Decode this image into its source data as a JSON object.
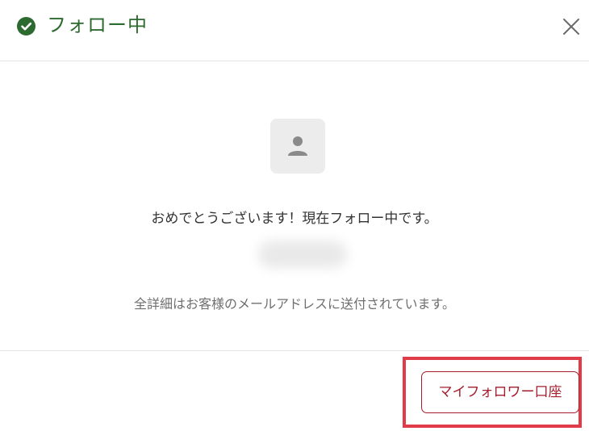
{
  "dialog": {
    "title": "フォロー中",
    "status_icon": "check-circle-icon",
    "close_icon": "close-icon",
    "accent_color": "#2d6a2f"
  },
  "body": {
    "avatar_icon": "user-placeholder-icon",
    "congrats_message": "おめでとうございます！現在フォロー中です。",
    "details_message": "全詳細はお客様のメールアドレスに送付されています。"
  },
  "footer": {
    "my_follow_account_label": "マイフォロワー口座",
    "button_color": "#a41d2d",
    "highlight_color": "#e03b48"
  }
}
